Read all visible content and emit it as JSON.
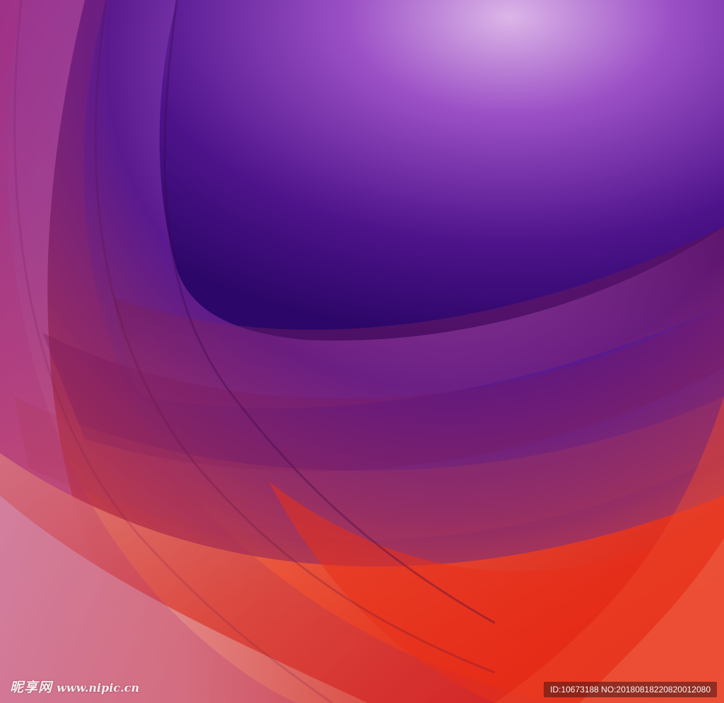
{
  "image": {
    "subject": "abstract-curved-waves",
    "colors": {
      "deep_purple": "#3a0a78",
      "violet": "#8a3cc0",
      "lilac_glow": "#d9b3e6",
      "magenta": "#a0306e",
      "red": "#e0200e",
      "orange": "#f26a44",
      "pale_pink": "#f4cdd4"
    }
  },
  "watermark": {
    "brand": "昵享网",
    "url": "www.nipic.cn",
    "id_text": "ID:10673188 NO:20180818220820012080"
  }
}
